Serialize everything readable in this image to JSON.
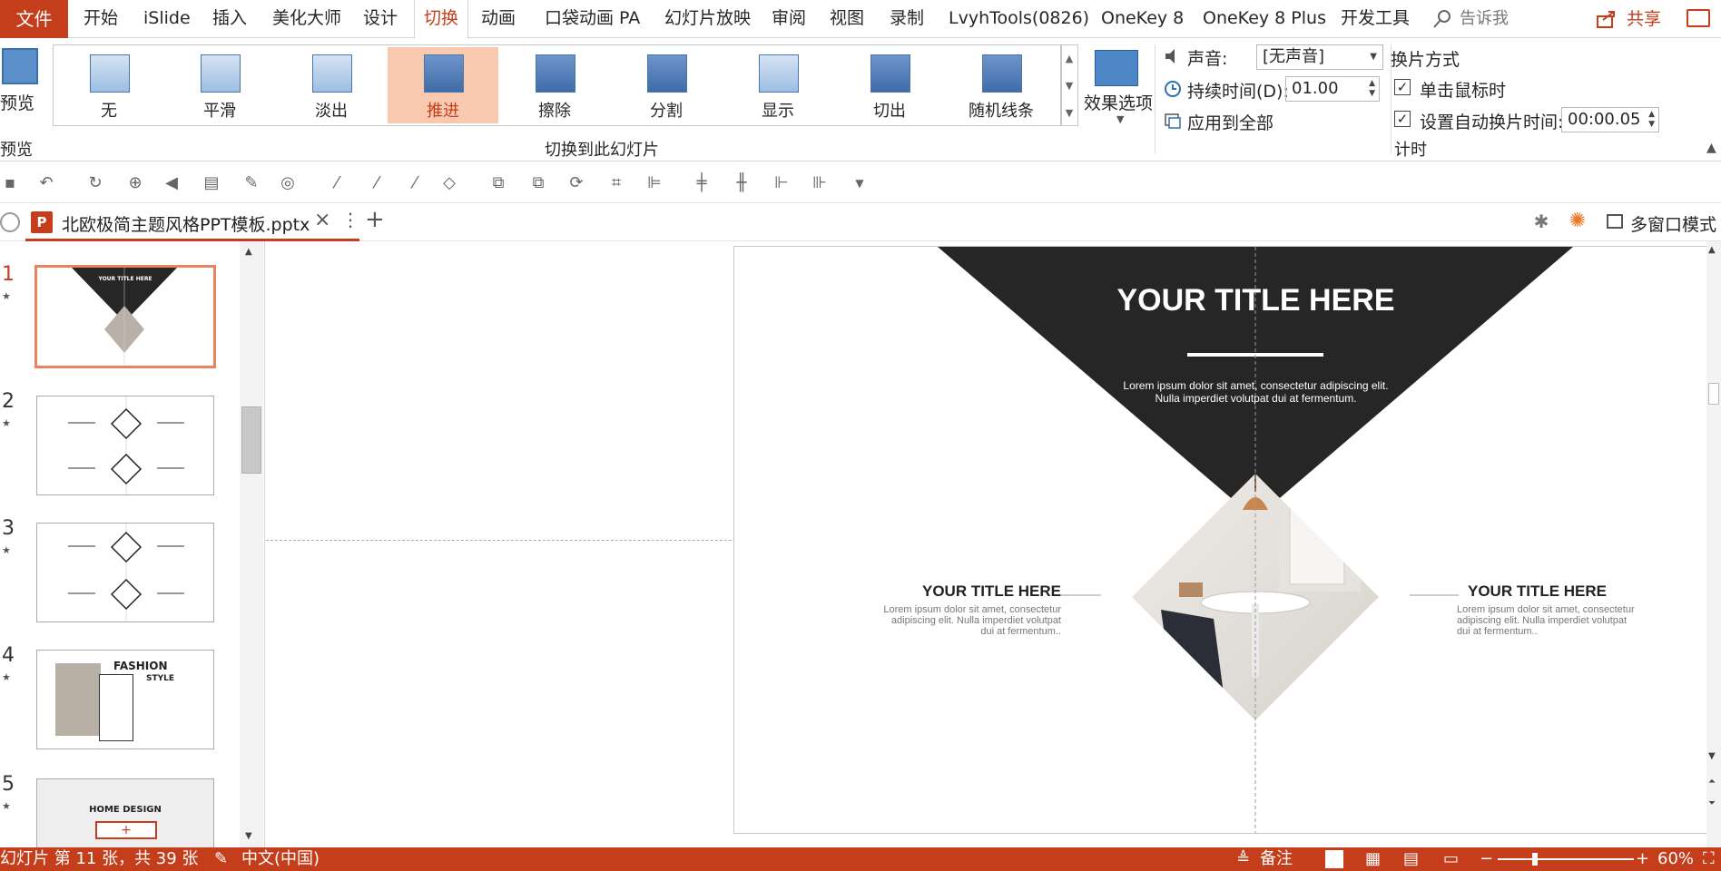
{
  "menu": {
    "file": "文件",
    "tabs": [
      "开始",
      "iSlide",
      "插入",
      "美化大师",
      "设计",
      "切换",
      "动画",
      "口袋动画 PA",
      "幻灯片放映",
      "审阅",
      "视图",
      "录制",
      "LvyhTools(0826)",
      "OneKey 8",
      "OneKey 8 Plus",
      "开发工具"
    ],
    "tell_me": "告诉我",
    "share": "共享"
  },
  "ribbon": {
    "preview_label": "预览",
    "preview_group": "预览",
    "transitions": [
      {
        "label": "无",
        "selected": false
      },
      {
        "label": "平滑",
        "selected": false
      },
      {
        "label": "淡出",
        "selected": false
      },
      {
        "label": "推进",
        "selected": true
      },
      {
        "label": "擦除",
        "selected": false
      },
      {
        "label": "分割",
        "selected": false
      },
      {
        "label": "显示",
        "selected": false
      },
      {
        "label": "切出",
        "selected": false
      },
      {
        "label": "随机线条",
        "selected": false
      }
    ],
    "transition_group": "切换到此幻灯片",
    "effect_options": "效果选项",
    "sound_label": "声音:",
    "sound_value": "[无声音]",
    "duration_label": "持续时间(D):",
    "duration_value": "01.00",
    "apply_all": "应用到全部",
    "advance_title": "换片方式",
    "on_click": "单击鼠标时",
    "on_click_checked": true,
    "after_label": "设置自动换片时间:",
    "after_checked": true,
    "after_value": "00:00.05",
    "timing_group": "计时"
  },
  "doc": {
    "filename": "北欧极简主题风格PPT模板.pptx",
    "multi_window": "多窗口模式"
  },
  "thumbnails": [
    {
      "num": "1",
      "title": "YOUR TITLE HERE",
      "current": true
    },
    {
      "num": "2",
      "title": "",
      "current": false
    },
    {
      "num": "3",
      "title": "",
      "current": false
    },
    {
      "num": "4",
      "title": "FASHION",
      "subtitle": "STYLE",
      "current": false
    },
    {
      "num": "5",
      "title": "HOME DESIGN",
      "current": false
    }
  ],
  "slide": {
    "title": "YOUR TITLE HERE",
    "body": "Lorem ipsum dolor sit amet, consectetur adipiscing elit.",
    "body2": "Nulla imperdiet volutpat dui at fermentum.",
    "left_title": "YOUR TITLE HERE",
    "left_body1": "Lorem ipsum dolor sit amet, consectetur",
    "left_body2": "adipiscing elit. Nulla imperdiet volutpat",
    "left_body3": "dui at fermentum..",
    "right_title": "YOUR TITLE HERE",
    "right_body1": "Lorem ipsum dolor sit amet, consectetur",
    "right_body2": "adipiscing elit. Nulla imperdiet volutpat",
    "right_body3": "dui at fermentum.."
  },
  "status": {
    "slide_info": "幻灯片 第 11 张，共 39 张",
    "language": "中文(中国)",
    "notes": "备注",
    "zoom": "60%"
  },
  "colors": {
    "accent": "#c43e1c",
    "selected_transition": "#f8c9af",
    "slide_dark": "#262626"
  }
}
